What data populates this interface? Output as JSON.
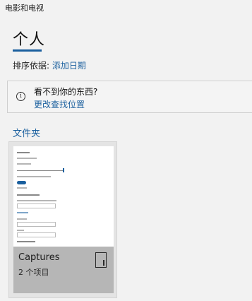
{
  "window": {
    "title": "电影和电视"
  },
  "pivot": {
    "active_label": "个人"
  },
  "sort": {
    "label": "排序依据:",
    "value": "添加日期"
  },
  "notice": {
    "title": "看不到你的东西?",
    "link": "更改查找位置"
  },
  "folders_section": {
    "title": "文件夹"
  },
  "folders": [
    {
      "name": "Captures",
      "item_count": "2 个项目"
    }
  ],
  "colors": {
    "accent": "#1a5f9e",
    "tile_panel": "#b6b6b6",
    "background": "#f2f2f2"
  },
  "icons": {
    "info": "info-icon",
    "folder": "folder-icon"
  }
}
